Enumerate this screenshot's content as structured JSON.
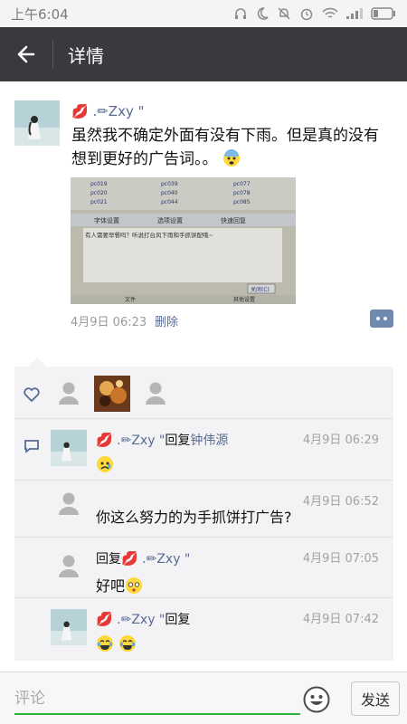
{
  "status_bar": {
    "time": "上午6:04"
  },
  "header": {
    "title": "详情"
  },
  "post": {
    "author": " .✏Zxy \"",
    "text": "虽然我不确定外面有没有下雨。但是真的没有想到更好的广告词。。",
    "time": "4月9日 06:23",
    "delete": "删除",
    "photo_labels": {
      "col1": [
        "pc019",
        "pc020",
        "pc021"
      ],
      "col2": [
        "pc039",
        "pc040",
        "pc044"
      ],
      "col3": [
        "pc077",
        "pc078",
        "pc085"
      ],
      "toolbar": [
        "字体设置",
        "选项设置",
        "快速回复"
      ],
      "message": "有人需要早餐吗？听说打台风下雨和手抓饼配哦~",
      "close_button": "关闭(C)",
      "bottom_left": "文件",
      "bottom_right": "其他设置"
    }
  },
  "comments": [
    {
      "name": " .✏Zxy \"",
      "reply_word": "回复",
      "reply_to": "钟伟源",
      "time": "4月9日 06:29",
      "text": ""
    },
    {
      "name": "",
      "reply_word": "",
      "reply_to": "",
      "time": "4月9日 06:52",
      "text": "你这么努力的为手抓饼打广告?"
    },
    {
      "name": " .✏Zxy \"",
      "reply_word": "回复",
      "reply_to": "",
      "time": "4月9日 07:05",
      "text": "好吧"
    },
    {
      "name": " .✏Zxy \"",
      "reply_word": "回复",
      "reply_to": "",
      "time": "4月9日 07:42",
      "text": ""
    }
  ],
  "input": {
    "placeholder": "评论",
    "send": "发送"
  },
  "colors": {
    "link": "#576b95",
    "titlebar": "#393a3f",
    "accent": "#2cb53c"
  },
  "icons": [
    "back-arrow-icon",
    "heart-icon",
    "comment-icon",
    "emoji-icon",
    "kiss-lips-icon"
  ]
}
